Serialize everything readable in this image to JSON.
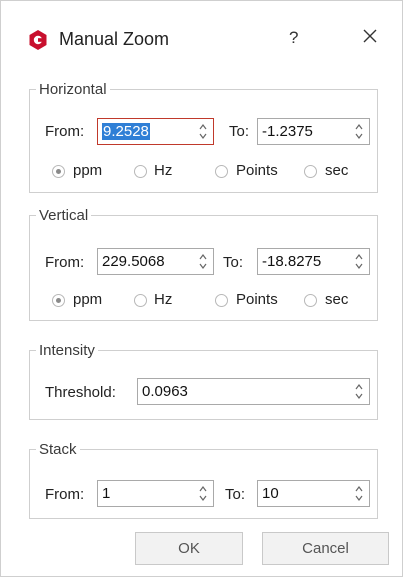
{
  "window": {
    "title": "Manual Zoom",
    "help_label": "?",
    "icon": "app-logo-icon",
    "close_icon": "close-icon"
  },
  "horizontal": {
    "legend": "Horizontal",
    "from_label": "From:",
    "from_value": "9.2528",
    "to_label": "To:",
    "to_value": "-1.2375",
    "units": [
      "ppm",
      "Hz",
      "Points",
      "sec"
    ],
    "selected_unit": "ppm"
  },
  "vertical": {
    "legend": "Vertical",
    "from_label": "From:",
    "from_value": "229.5068",
    "to_label": "To:",
    "to_value": "-18.8275",
    "units": [
      "ppm",
      "Hz",
      "Points",
      "sec"
    ],
    "selected_unit": "ppm"
  },
  "intensity": {
    "legend": "Intensity",
    "threshold_label": "Threshold:",
    "threshold_value": "0.0963"
  },
  "stack": {
    "legend": "Stack",
    "from_label": "From:",
    "from_value": "1",
    "to_label": "To:",
    "to_value": "10"
  },
  "buttons": {
    "ok_label": "OK",
    "cancel_label": "Cancel"
  },
  "colors": {
    "focus_border": "#c0392b",
    "selection": "#2f7fd6",
    "app_icon": "#c8102e"
  }
}
